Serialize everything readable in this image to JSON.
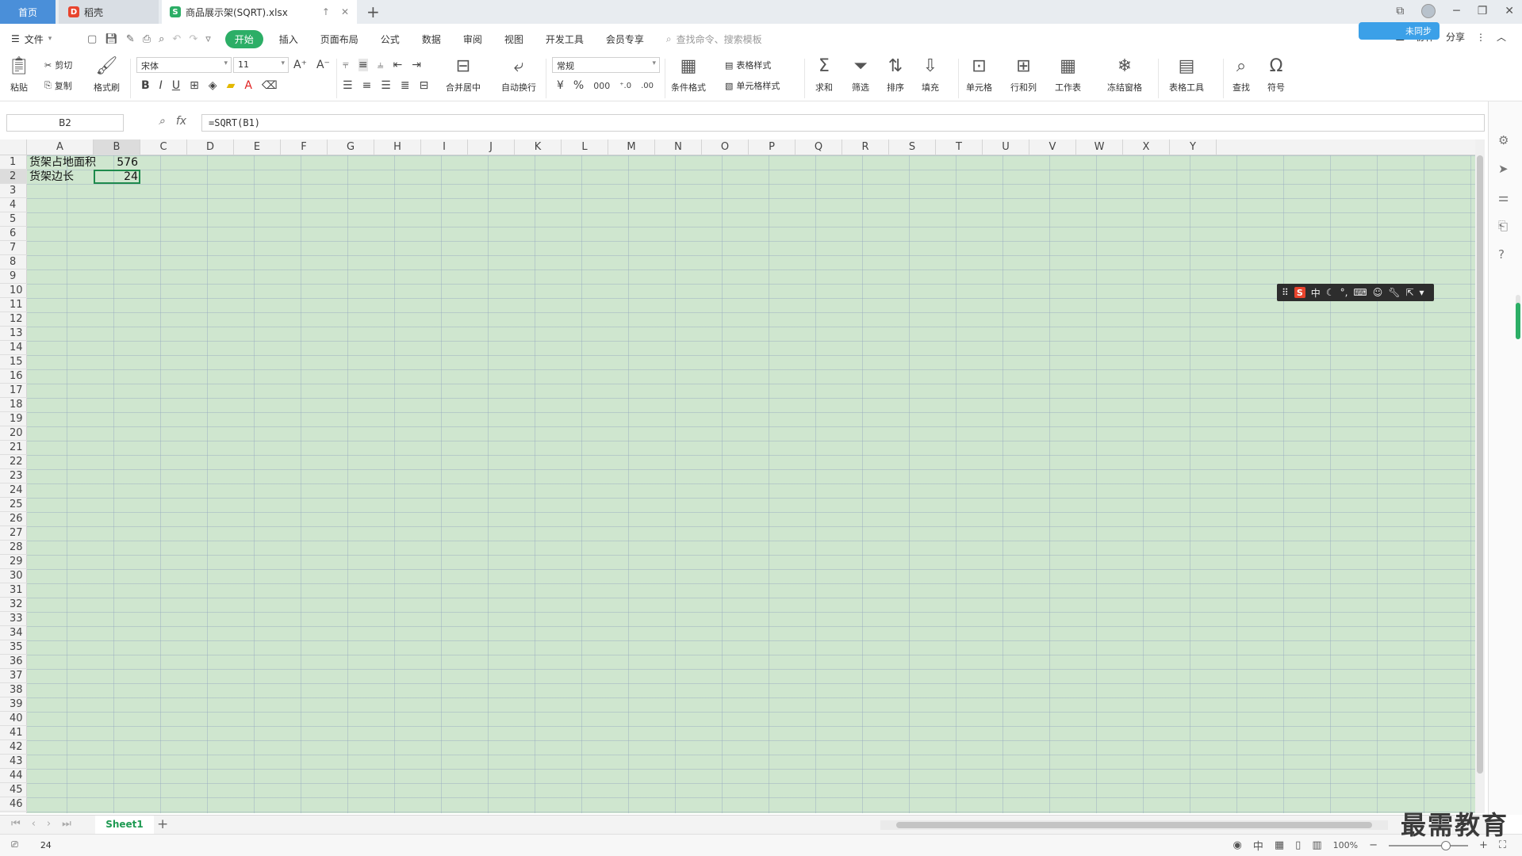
{
  "tabs": {
    "home": "首页",
    "daoke": "稻壳",
    "file": "商品展示架(SQRT).xlsx"
  },
  "menu": {
    "file": "文件",
    "items": [
      "开始",
      "插入",
      "页面布局",
      "公式",
      "数据",
      "审阅",
      "视图",
      "开发工具",
      "会员专享"
    ],
    "search_placeholder": "查找命令、搜索模板",
    "sync_label": "未同步",
    "collab_label": "协作",
    "share_label": "分享"
  },
  "ribbon": {
    "paste": "粘贴",
    "cut": "剪切",
    "copy": "复制",
    "format_painter": "格式刷",
    "font_name": "宋体",
    "font_size": "11",
    "merge_center": "合并居中",
    "wrap_text": "自动换行",
    "number_format": "常规",
    "conditional_format": "条件格式",
    "table_style": "表格样式",
    "cell_style": "单元格样式",
    "sum": "求和",
    "filter": "筛选",
    "sort": "排序",
    "fill": "填充",
    "cell": "单元格",
    "rows_cols": "行和列",
    "worksheet": "工作表",
    "freeze_panes": "冻结窗格",
    "table_tools": "表格工具",
    "find": "查找",
    "symbol": "符号"
  },
  "formula_bar": {
    "name_box": "B2",
    "fx": "fx",
    "formula": "=SQRT(B1)"
  },
  "grid": {
    "columns": [
      "A",
      "B",
      "C",
      "D",
      "E",
      "F",
      "G",
      "H",
      "I",
      "J",
      "K",
      "L",
      "M",
      "N",
      "O",
      "P",
      "Q",
      "R",
      "S",
      "T",
      "U",
      "V",
      "W",
      "X",
      "Y"
    ],
    "rows": [
      "1",
      "2",
      "3",
      "4",
      "5",
      "6",
      "7",
      "8",
      "9",
      "10",
      "11",
      "12",
      "13",
      "14",
      "15",
      "16",
      "17",
      "18",
      "19",
      "20",
      "21",
      "22",
      "23",
      "24",
      "25",
      "26",
      "27",
      "28",
      "29",
      "30",
      "31",
      "32",
      "33",
      "34",
      "35",
      "36",
      "37",
      "38",
      "39",
      "40",
      "41",
      "42",
      "43",
      "44",
      "45",
      "46"
    ],
    "cells": {
      "A1": "货架占地面积",
      "B1": "576",
      "A2": "货架边长",
      "B2": "24"
    },
    "selected_cell": "B2",
    "sheet_bg_color": "#cfe6cf"
  },
  "ime_toolbar": {
    "logo": "S",
    "mode": "中"
  },
  "sheets": [
    "Sheet1"
  ],
  "status": {
    "value": "24",
    "zoom": "100%"
  },
  "watermark": "最需教育"
}
